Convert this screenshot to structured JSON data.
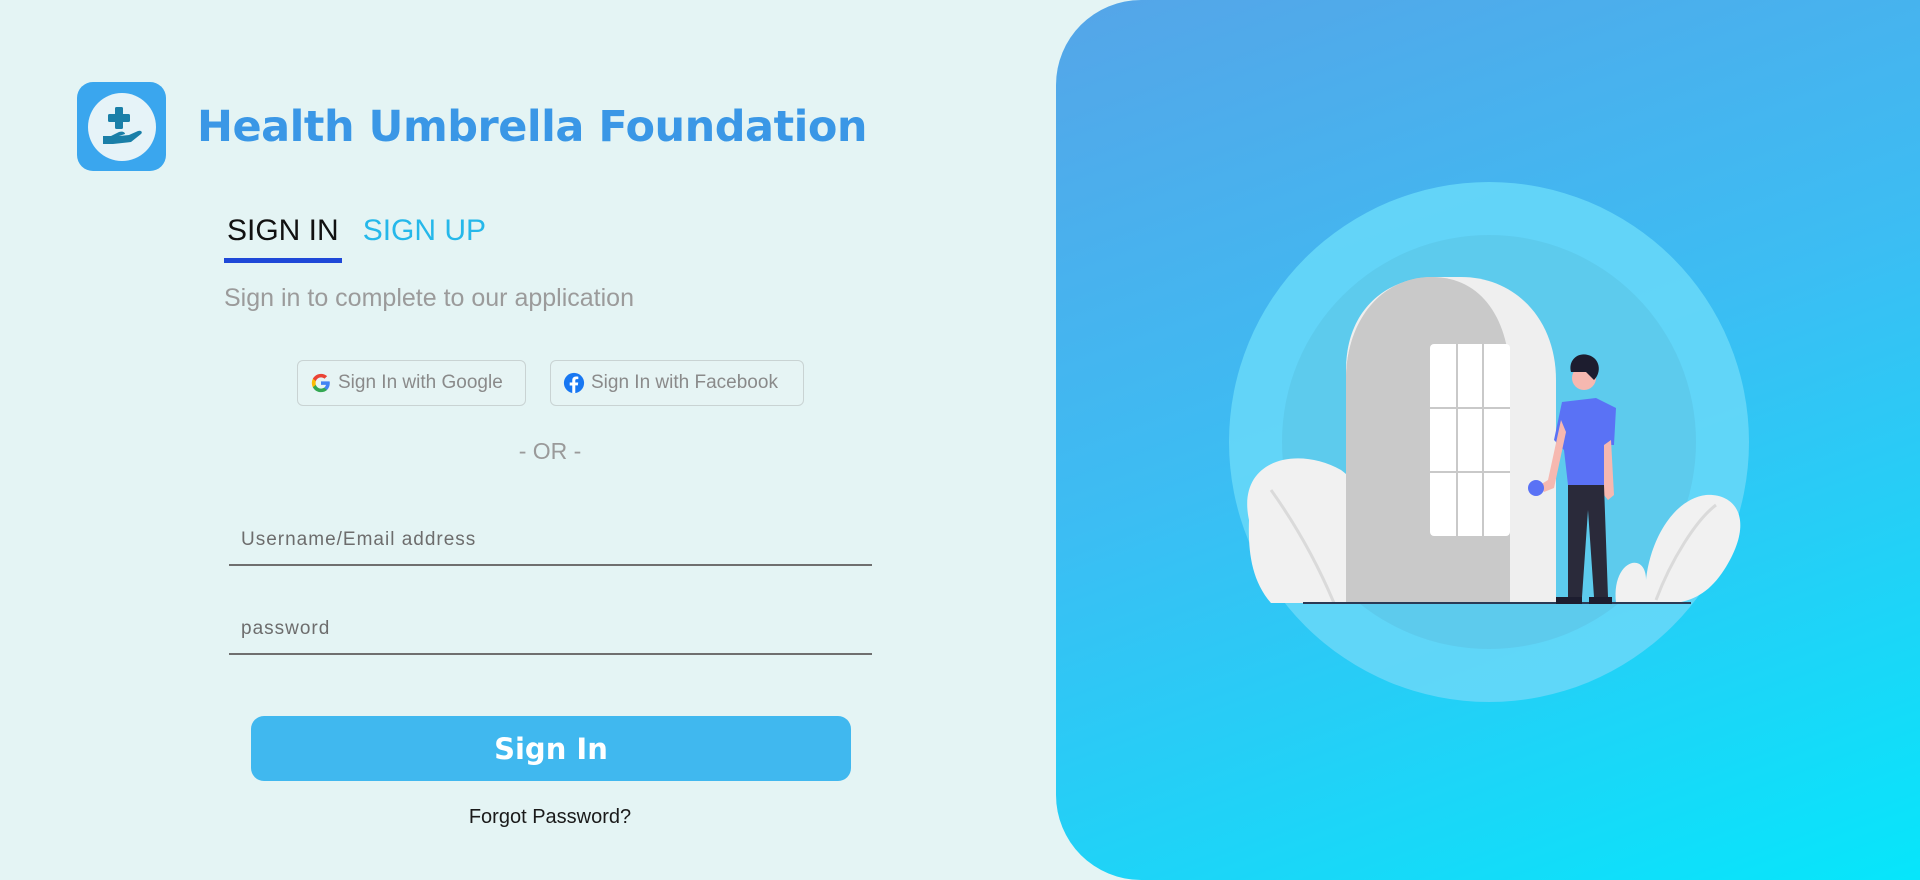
{
  "brand": {
    "title": "Health Umbrella Foundation"
  },
  "tabs": [
    {
      "label": "SIGN IN",
      "active": true
    },
    {
      "label": "SIGN UP",
      "active": false
    }
  ],
  "subtitle": "Sign in to complete to our application",
  "social": {
    "google_label": "Sign In with Google",
    "facebook_label": "Sign In with Facebook"
  },
  "divider_text": "- OR -",
  "form": {
    "username_placeholder": "Username/Email address",
    "username_value": "",
    "password_placeholder": "password",
    "password_value": ""
  },
  "signin_button_label": "Sign In",
  "forgot_password_label": "Forgot Password?",
  "colors": {
    "brand_blue": "#3a97e6",
    "tab_active_underline": "#1e48d8",
    "tab_inactive": "#25b8ea",
    "button": "#40b8ef",
    "background": "#e4f4f4"
  },
  "icons": {
    "logo": "hand-with-medical-cross-icon",
    "google": "google-g-icon",
    "facebook": "facebook-icon"
  }
}
